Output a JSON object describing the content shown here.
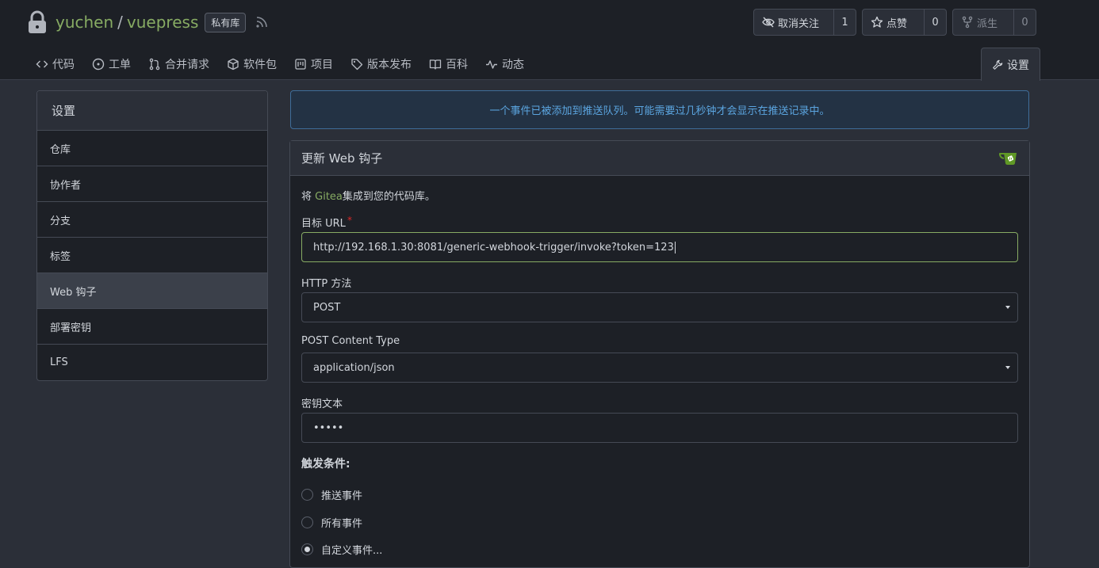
{
  "repo": {
    "owner": "yuchen",
    "separator": "/",
    "name": "vuepress",
    "visibility_badge": "私有库"
  },
  "actions": {
    "watch": {
      "label": "取消关注",
      "count": "1"
    },
    "star": {
      "label": "点赞",
      "count": "0"
    },
    "fork": {
      "label": "派生",
      "count": "0"
    }
  },
  "tabs": [
    {
      "label": "代码",
      "icon": "code-icon"
    },
    {
      "label": "工单",
      "icon": "issue-icon"
    },
    {
      "label": "合并请求",
      "icon": "pull-request-icon"
    },
    {
      "label": "软件包",
      "icon": "package-icon"
    },
    {
      "label": "项目",
      "icon": "project-icon"
    },
    {
      "label": "版本发布",
      "icon": "tag-icon"
    },
    {
      "label": "百科",
      "icon": "book-icon"
    },
    {
      "label": "动态",
      "icon": "pulse-icon"
    }
  ],
  "settings_tab": {
    "label": "设置",
    "icon": "tools-icon"
  },
  "sidebar": {
    "title": "设置",
    "items": [
      {
        "label": "仓库"
      },
      {
        "label": "协作者"
      },
      {
        "label": "分支"
      },
      {
        "label": "标签"
      },
      {
        "label": "Web 钩子",
        "active": true
      },
      {
        "label": "部署密钥"
      },
      {
        "label": "LFS"
      }
    ]
  },
  "notice": "一个事件已被添加到推送队列。可能需要过几秒钟才会显示在推送记录中。",
  "form": {
    "title": "更新 Web 钩子",
    "desc_prefix": "将 ",
    "desc_link": "Gitea",
    "desc_suffix": "集成到您的代码库。",
    "target_url_label": "目标 URL",
    "target_url_required": "*",
    "target_url_value": "http://192.168.1.30:8081/generic-webhook-trigger/invoke?token=123",
    "http_method_label": "HTTP 方法",
    "http_method_value": "POST",
    "content_type_label": "POST Content Type",
    "content_type_value": "application/json",
    "secret_label": "密钥文本",
    "secret_value": "•••••",
    "trigger_label": "触发条件:",
    "trigger_options": [
      {
        "label": "推送事件",
        "checked": false
      },
      {
        "label": "所有事件",
        "checked": false
      },
      {
        "label": "自定义事件...",
        "checked": true
      }
    ]
  },
  "colors": {
    "accent": "#87ab63",
    "background": "#2b2f38",
    "header": "#1d2026",
    "notice_text": "#5ba5e0",
    "required": "#db2828"
  }
}
